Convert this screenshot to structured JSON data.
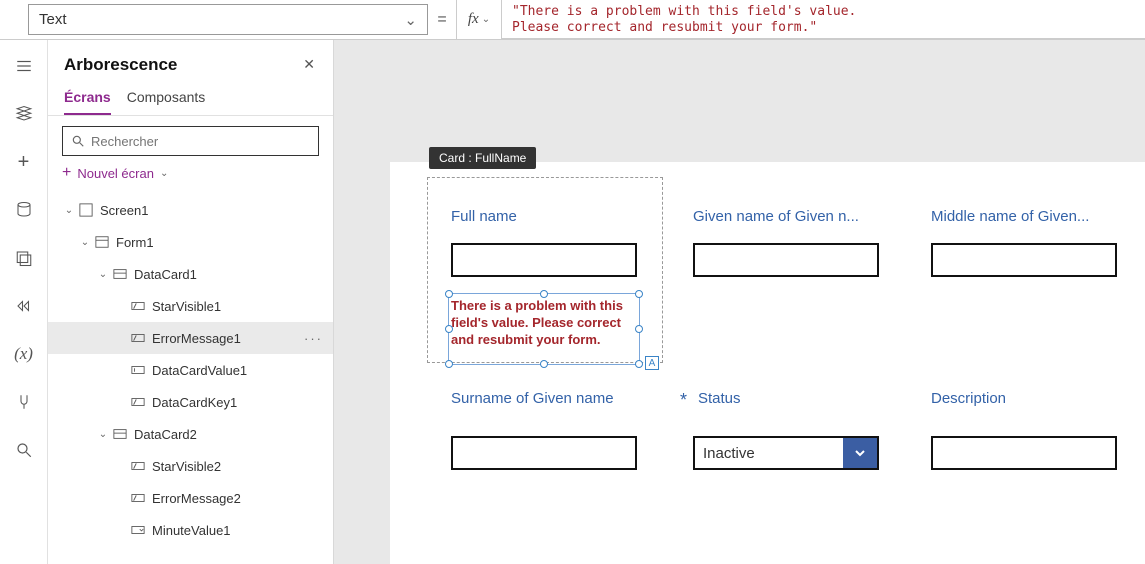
{
  "property_selector": {
    "value": "Text"
  },
  "formula": "\"There is a problem with this field's value.\nPlease correct and resubmit your form.\"",
  "panel": {
    "title": "Arborescence",
    "tabs": {
      "screens": "Écrans",
      "components": "Composants"
    },
    "search_placeholder": "Rechercher",
    "new_screen": "Nouvel écran"
  },
  "tree": {
    "screen1": "Screen1",
    "form1": "Form1",
    "datacard1": "DataCard1",
    "starvisible1": "StarVisible1",
    "errormessage1": "ErrorMessage1",
    "datacardvalue1": "DataCardValue1",
    "datacardkey1": "DataCardKey1",
    "datacard2": "DataCard2",
    "starvisible2": "StarVisible2",
    "errormessage2": "ErrorMessage2",
    "minutevalue1": "MinuteValue1"
  },
  "canvas": {
    "card_chip": "Card : FullName",
    "labels": {
      "fullname": "Full name",
      "given": "Given name of Given n...",
      "middle": "Middle name of Given...",
      "surname": "Surname of Given name",
      "status": "Status",
      "description": "Description"
    },
    "error_text": "There is a problem with this field's value.  Please correct and resubmit your form.",
    "status_value": "Inactive"
  }
}
